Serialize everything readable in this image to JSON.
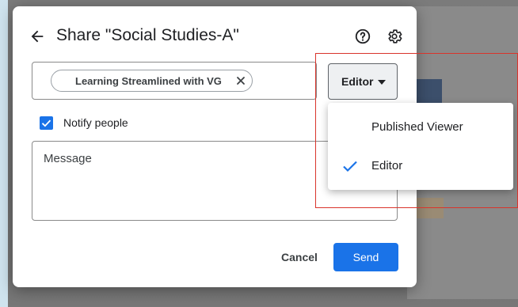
{
  "dialog": {
    "title": "Share \"Social Studies-A\"",
    "icons": [
      "back-arrow-icon",
      "help-icon",
      "gear-icon"
    ]
  },
  "people_field": {
    "chip_label": "Learning Streamlined with VG"
  },
  "role_button": {
    "label": "Editor"
  },
  "notify": {
    "label": "Notify people",
    "checked": true
  },
  "message": {
    "placeholder": "Message"
  },
  "footer": {
    "cancel_label": "Cancel",
    "send_label": "Send"
  },
  "role_menu": {
    "items": [
      {
        "label": "Published Viewer",
        "selected": false
      },
      {
        "label": "Editor",
        "selected": true
      }
    ]
  },
  "colors": {
    "accent": "#1a73e8",
    "highlight": "#d9342b"
  }
}
